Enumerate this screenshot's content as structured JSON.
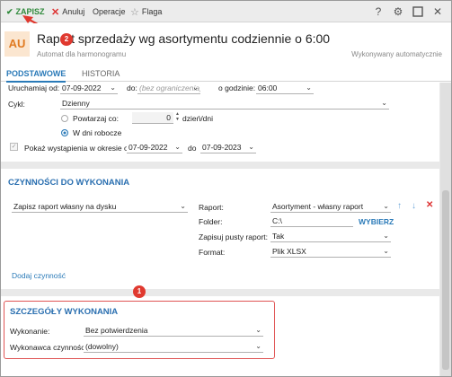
{
  "toolbar": {
    "save_label": "ZAPISZ",
    "cancel_label": "Anuluj",
    "operations_label": "Operacje",
    "flag_label": "Flaga",
    "help_label": "?"
  },
  "header": {
    "avatar": "AU",
    "title": "Raport sprzedaży wg asortymentu codziennie o 6:00",
    "subtitle": "Automat dla harmonogramu",
    "status": "Wykonywany automatycznie"
  },
  "tabs": [
    {
      "label": "PODSTAWOWE",
      "active": true
    },
    {
      "label": "HISTORIA",
      "active": false
    }
  ],
  "schedule": {
    "start_label": "Uruchamiaj od:",
    "start_value": "07-09-2022",
    "until_label": "do:",
    "until_placeholder": "(bez ograniczenia)",
    "time_label": "o godzinie:",
    "time_value": "06:00",
    "cycle_label": "Cykl:",
    "cycle_value": "Dzienny",
    "repeat_label": "Powtarzaj co:",
    "repeat_value": "0",
    "repeat_unit": "dzień/dni",
    "workdays_label": "W dni robocze",
    "show_label": "Pokaż wystąpienia w okresie od",
    "show_from": "07-09-2022",
    "show_to_label": "do",
    "show_to": "07-09-2023"
  },
  "actions": {
    "title": "CZYNNOŚCI DO WYKONANIA",
    "action_value": "Zapisz raport własny na dysku",
    "report_label": "Raport:",
    "report_value": "Asortyment - własny raport",
    "folder_label": "Folder:",
    "folder_value": "C:\\",
    "choose_label": "WYBIERZ",
    "empty_label": "Zapisuj pusty raport:",
    "empty_value": "Tak",
    "format_label": "Format:",
    "format_value": "Plik XLSX",
    "add_label": "Dodaj czynność"
  },
  "details": {
    "title": "SZCZEGÓŁY WYKONANIA",
    "execution_label": "Wykonanie:",
    "execution_value": "Bez potwierdzenia",
    "executor_label": "Wykonawca czynności:",
    "executor_value": "(dowolny)"
  },
  "badges": {
    "one": "1",
    "two": "2"
  },
  "colors": {
    "accent": "#2a7ab8",
    "save": "#2f8a3b",
    "highlight": "#e05555",
    "badge": "#e0392f",
    "avatar_bg": "#fbe6d0",
    "avatar_fg": "#e07a20"
  }
}
